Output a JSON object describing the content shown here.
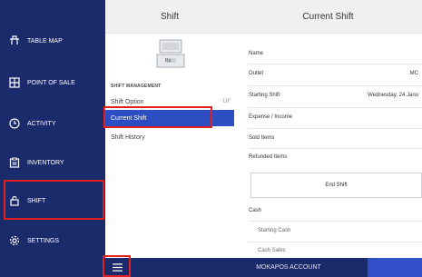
{
  "sidebar": {
    "items": [
      {
        "label": "TABLE MAP",
        "icon": "table-map-icon"
      },
      {
        "label": "POINT OF SALE",
        "icon": "point-of-sale-icon"
      },
      {
        "label": "ACTIVITY",
        "icon": "clock-icon"
      },
      {
        "label": "INVENTORY",
        "icon": "clipboard-icon"
      },
      {
        "label": "SHIFT",
        "icon": "lock-icon"
      },
      {
        "label": "SETTINGS",
        "icon": "gear-icon"
      }
    ],
    "active": "SHIFT"
  },
  "shift_panel": {
    "title": "Shift",
    "register_label": "Rp",
    "section_label": "SHIFT MANAGEMENT",
    "items": [
      {
        "label": "Shift Option",
        "sub": "OF"
      },
      {
        "label": "Current Shift"
      },
      {
        "label": "Shift History"
      }
    ],
    "active": "Current Shift"
  },
  "current_shift": {
    "title": "Current Shift",
    "fields": [
      {
        "label": "Name",
        "value": ""
      },
      {
        "label": "Outlet",
        "value": "MC"
      },
      {
        "label": "Starting Shift",
        "value": "Wednesday, 24 Janu"
      },
      {
        "label": "Expense / Income",
        "value": ""
      },
      {
        "label": "Sold Items",
        "value": ""
      },
      {
        "label": "Refunded Items",
        "value": ""
      }
    ],
    "end_shift_label": "End Shift",
    "cash_label": "Cash",
    "cash_rows": [
      "Starting Cash",
      "Cash Sales"
    ]
  },
  "bottom_bar": {
    "menu_icon": "hamburger-icon",
    "account_label": "MOKAPOS ACCOUNT"
  },
  "colors": {
    "sidebar_bg": "#1b2a6b",
    "active_blue": "#2d4ec2",
    "highlight_red": "#e02020"
  }
}
